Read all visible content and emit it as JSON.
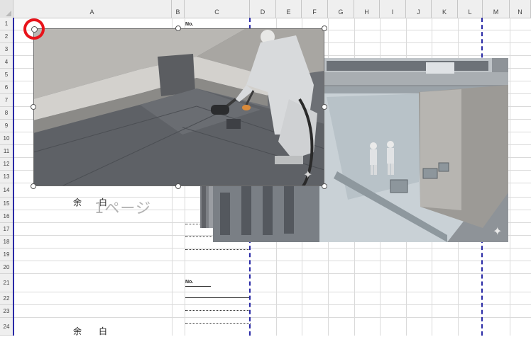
{
  "columns": [
    "A",
    "B",
    "C",
    "D",
    "E",
    "F",
    "G",
    "H",
    "I",
    "J",
    "K",
    "L",
    "M",
    "N"
  ],
  "rows": [
    "1",
    "2",
    "3",
    "4",
    "5",
    "6",
    "7",
    "8",
    "9",
    "10",
    "11",
    "12",
    "13",
    "14",
    "15",
    "16",
    "17",
    "18",
    "19",
    "20",
    "21",
    "22",
    "23",
    "24"
  ],
  "cells": {
    "small_label_1": "No.",
    "small_label_2": "No.",
    "yohaku_1": "余白",
    "yohaku_2": "余白",
    "page_watermark": "1ページ"
  },
  "colors": {
    "page_break": "#2a2aa6",
    "rotation_highlight": "#e8141b",
    "header_bg": "#efefef"
  },
  "images": [
    {
      "name": "roof-waterproofing-photo-1",
      "icon": "photo-icon"
    },
    {
      "name": "roof-waterproofing-photo-2",
      "icon": "photo-icon"
    },
    {
      "name": "roof-waterproofing-photo-3",
      "icon": "photo-icon"
    }
  ]
}
